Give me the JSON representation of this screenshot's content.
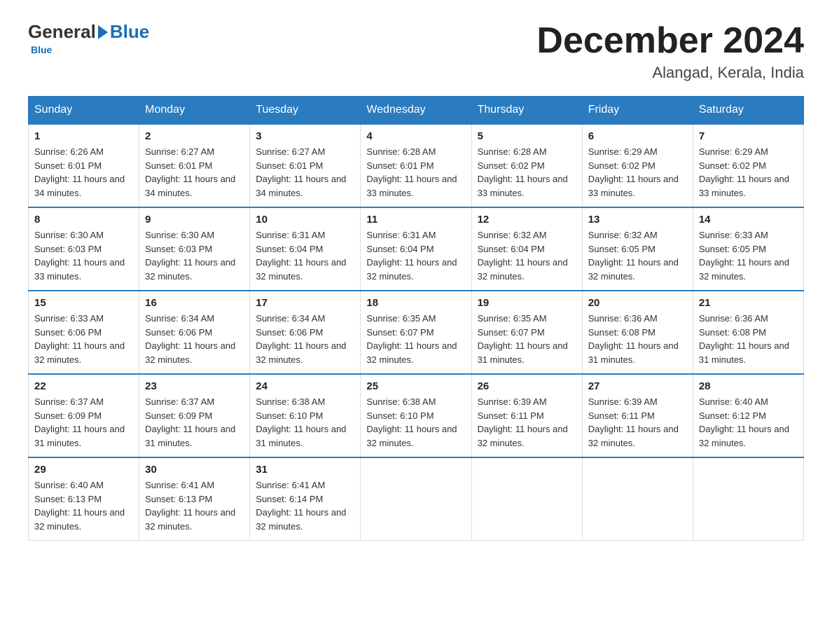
{
  "logo": {
    "general": "General",
    "blue": "Blue",
    "tagline": "Blue"
  },
  "header": {
    "month": "December 2024",
    "location": "Alangad, Kerala, India"
  },
  "weekdays": [
    "Sunday",
    "Monday",
    "Tuesday",
    "Wednesday",
    "Thursday",
    "Friday",
    "Saturday"
  ],
  "weeks": [
    [
      {
        "day": "1",
        "sunrise": "6:26 AM",
        "sunset": "6:01 PM",
        "daylight": "11 hours and 34 minutes."
      },
      {
        "day": "2",
        "sunrise": "6:27 AM",
        "sunset": "6:01 PM",
        "daylight": "11 hours and 34 minutes."
      },
      {
        "day": "3",
        "sunrise": "6:27 AM",
        "sunset": "6:01 PM",
        "daylight": "11 hours and 34 minutes."
      },
      {
        "day": "4",
        "sunrise": "6:28 AM",
        "sunset": "6:01 PM",
        "daylight": "11 hours and 33 minutes."
      },
      {
        "day": "5",
        "sunrise": "6:28 AM",
        "sunset": "6:02 PM",
        "daylight": "11 hours and 33 minutes."
      },
      {
        "day": "6",
        "sunrise": "6:29 AM",
        "sunset": "6:02 PM",
        "daylight": "11 hours and 33 minutes."
      },
      {
        "day": "7",
        "sunrise": "6:29 AM",
        "sunset": "6:02 PM",
        "daylight": "11 hours and 33 minutes."
      }
    ],
    [
      {
        "day": "8",
        "sunrise": "6:30 AM",
        "sunset": "6:03 PM",
        "daylight": "11 hours and 33 minutes."
      },
      {
        "day": "9",
        "sunrise": "6:30 AM",
        "sunset": "6:03 PM",
        "daylight": "11 hours and 32 minutes."
      },
      {
        "day": "10",
        "sunrise": "6:31 AM",
        "sunset": "6:04 PM",
        "daylight": "11 hours and 32 minutes."
      },
      {
        "day": "11",
        "sunrise": "6:31 AM",
        "sunset": "6:04 PM",
        "daylight": "11 hours and 32 minutes."
      },
      {
        "day": "12",
        "sunrise": "6:32 AM",
        "sunset": "6:04 PM",
        "daylight": "11 hours and 32 minutes."
      },
      {
        "day": "13",
        "sunrise": "6:32 AM",
        "sunset": "6:05 PM",
        "daylight": "11 hours and 32 minutes."
      },
      {
        "day": "14",
        "sunrise": "6:33 AM",
        "sunset": "6:05 PM",
        "daylight": "11 hours and 32 minutes."
      }
    ],
    [
      {
        "day": "15",
        "sunrise": "6:33 AM",
        "sunset": "6:06 PM",
        "daylight": "11 hours and 32 minutes."
      },
      {
        "day": "16",
        "sunrise": "6:34 AM",
        "sunset": "6:06 PM",
        "daylight": "11 hours and 32 minutes."
      },
      {
        "day": "17",
        "sunrise": "6:34 AM",
        "sunset": "6:06 PM",
        "daylight": "11 hours and 32 minutes."
      },
      {
        "day": "18",
        "sunrise": "6:35 AM",
        "sunset": "6:07 PM",
        "daylight": "11 hours and 32 minutes."
      },
      {
        "day": "19",
        "sunrise": "6:35 AM",
        "sunset": "6:07 PM",
        "daylight": "11 hours and 31 minutes."
      },
      {
        "day": "20",
        "sunrise": "6:36 AM",
        "sunset": "6:08 PM",
        "daylight": "11 hours and 31 minutes."
      },
      {
        "day": "21",
        "sunrise": "6:36 AM",
        "sunset": "6:08 PM",
        "daylight": "11 hours and 31 minutes."
      }
    ],
    [
      {
        "day": "22",
        "sunrise": "6:37 AM",
        "sunset": "6:09 PM",
        "daylight": "11 hours and 31 minutes."
      },
      {
        "day": "23",
        "sunrise": "6:37 AM",
        "sunset": "6:09 PM",
        "daylight": "11 hours and 31 minutes."
      },
      {
        "day": "24",
        "sunrise": "6:38 AM",
        "sunset": "6:10 PM",
        "daylight": "11 hours and 31 minutes."
      },
      {
        "day": "25",
        "sunrise": "6:38 AM",
        "sunset": "6:10 PM",
        "daylight": "11 hours and 32 minutes."
      },
      {
        "day": "26",
        "sunrise": "6:39 AM",
        "sunset": "6:11 PM",
        "daylight": "11 hours and 32 minutes."
      },
      {
        "day": "27",
        "sunrise": "6:39 AM",
        "sunset": "6:11 PM",
        "daylight": "11 hours and 32 minutes."
      },
      {
        "day": "28",
        "sunrise": "6:40 AM",
        "sunset": "6:12 PM",
        "daylight": "11 hours and 32 minutes."
      }
    ],
    [
      {
        "day": "29",
        "sunrise": "6:40 AM",
        "sunset": "6:13 PM",
        "daylight": "11 hours and 32 minutes."
      },
      {
        "day": "30",
        "sunrise": "6:41 AM",
        "sunset": "6:13 PM",
        "daylight": "11 hours and 32 minutes."
      },
      {
        "day": "31",
        "sunrise": "6:41 AM",
        "sunset": "6:14 PM",
        "daylight": "11 hours and 32 minutes."
      },
      null,
      null,
      null,
      null
    ]
  ],
  "labels": {
    "sunrise": "Sunrise:",
    "sunset": "Sunset:",
    "daylight": "Daylight:"
  }
}
